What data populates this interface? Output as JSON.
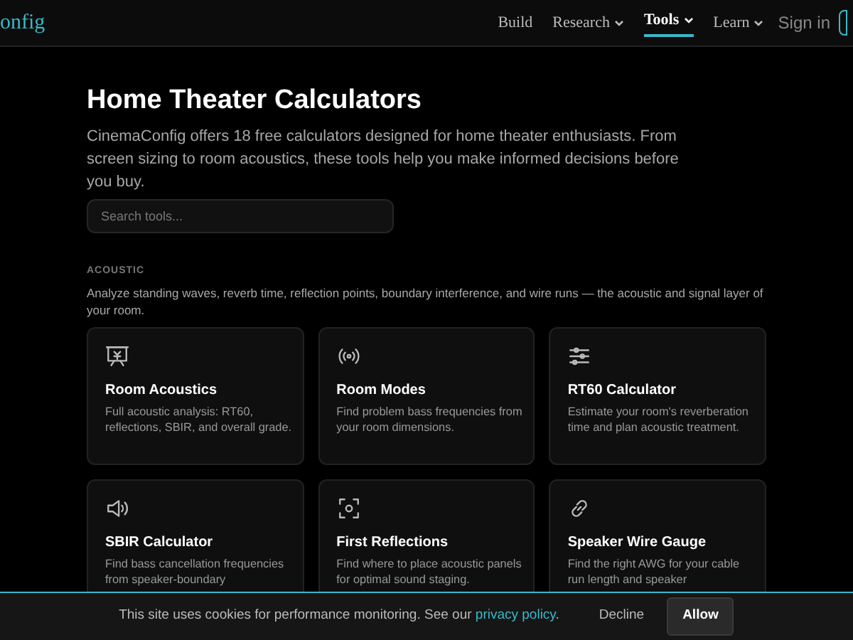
{
  "nav": {
    "logo": "onfig",
    "items": [
      {
        "label": "Build",
        "dropdown": false,
        "selected": false
      },
      {
        "label": "Research",
        "dropdown": true,
        "selected": false
      },
      {
        "label": "Tools",
        "dropdown": true,
        "selected": true
      },
      {
        "label": "Learn",
        "dropdown": true,
        "selected": false
      }
    ],
    "sign_in": "Sign in"
  },
  "title": "Home Theater Calculators",
  "intro": "CinemaConfig offers 18 free calculators designed for home theater enthusiasts. From screen sizing to room acoustics, these tools help you make informed decisions before you buy.",
  "search": {
    "placeholder": "Search tools..."
  },
  "section": {
    "label": "ACOUSTIC",
    "description": "Analyze standing waves, reverb time, reflection points, boundary interference, and wire runs — the acoustic and signal layer of your room.",
    "cards": [
      {
        "title": "Room Acoustics",
        "description": "Full acoustic analysis: RT60, reflections, SBIR, and overall grade."
      },
      {
        "title": "Room Modes",
        "description": "Find problem bass frequencies from your room dimensions."
      },
      {
        "title": "RT60 Calculator",
        "description": "Estimate your room's reverberation time and plan acoustic treatment."
      },
      {
        "title": "SBIR Calculator",
        "description": "Find bass cancellation frequencies from speaker-boundary"
      },
      {
        "title": "First Reflections",
        "description": "Find where to place acoustic panels for optimal sound staging."
      },
      {
        "title": "Speaker Wire Gauge",
        "description": "Find the right AWG for your cable run length and speaker"
      }
    ]
  },
  "cookie_banner": {
    "text_before": "This site uses cookies for performance monitoring. See our",
    "link": "privacy policy",
    "text_after": ".",
    "decline": "Decline",
    "allow": "Allow"
  }
}
